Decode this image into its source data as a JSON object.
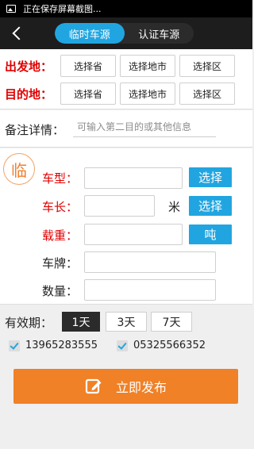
{
  "status": {
    "text": "正在保存屏幕截图..."
  },
  "title_tabs": [
    {
      "label": "临时车源"
    },
    {
      "label": "认证车源"
    }
  ],
  "route": {
    "origin": {
      "label": "出发地：",
      "province": "选择省",
      "city": "选择地市",
      "district": "选择区"
    },
    "destination": {
      "label": "目的地：",
      "province": "选择省",
      "city": "选择地市",
      "district": "选择区"
    }
  },
  "remark": {
    "label": "备注详情：",
    "placeholder": "可输入第二目的或其他信息"
  },
  "vehicle": {
    "badge": "临",
    "type_label": "车型：",
    "type_button": "选择",
    "length_label": "车长：",
    "length_unit": "米",
    "length_button": "选择",
    "load_label": "载重：",
    "load_unit": "吨",
    "plate_label": "车牌：",
    "quantity_label": "数量："
  },
  "validity": {
    "label": "有效期：",
    "options": [
      "1天",
      "3天",
      "7天"
    ],
    "selected": "1天"
  },
  "contacts": [
    {
      "phone": "13965283555",
      "checked": true
    },
    {
      "phone": "05325566352",
      "checked": true
    }
  ],
  "publish": {
    "label": "立即发布"
  },
  "colors": {
    "accent_blue": "#21a5e0",
    "publish_orange": "#f08126",
    "required_red": "#e10000"
  }
}
